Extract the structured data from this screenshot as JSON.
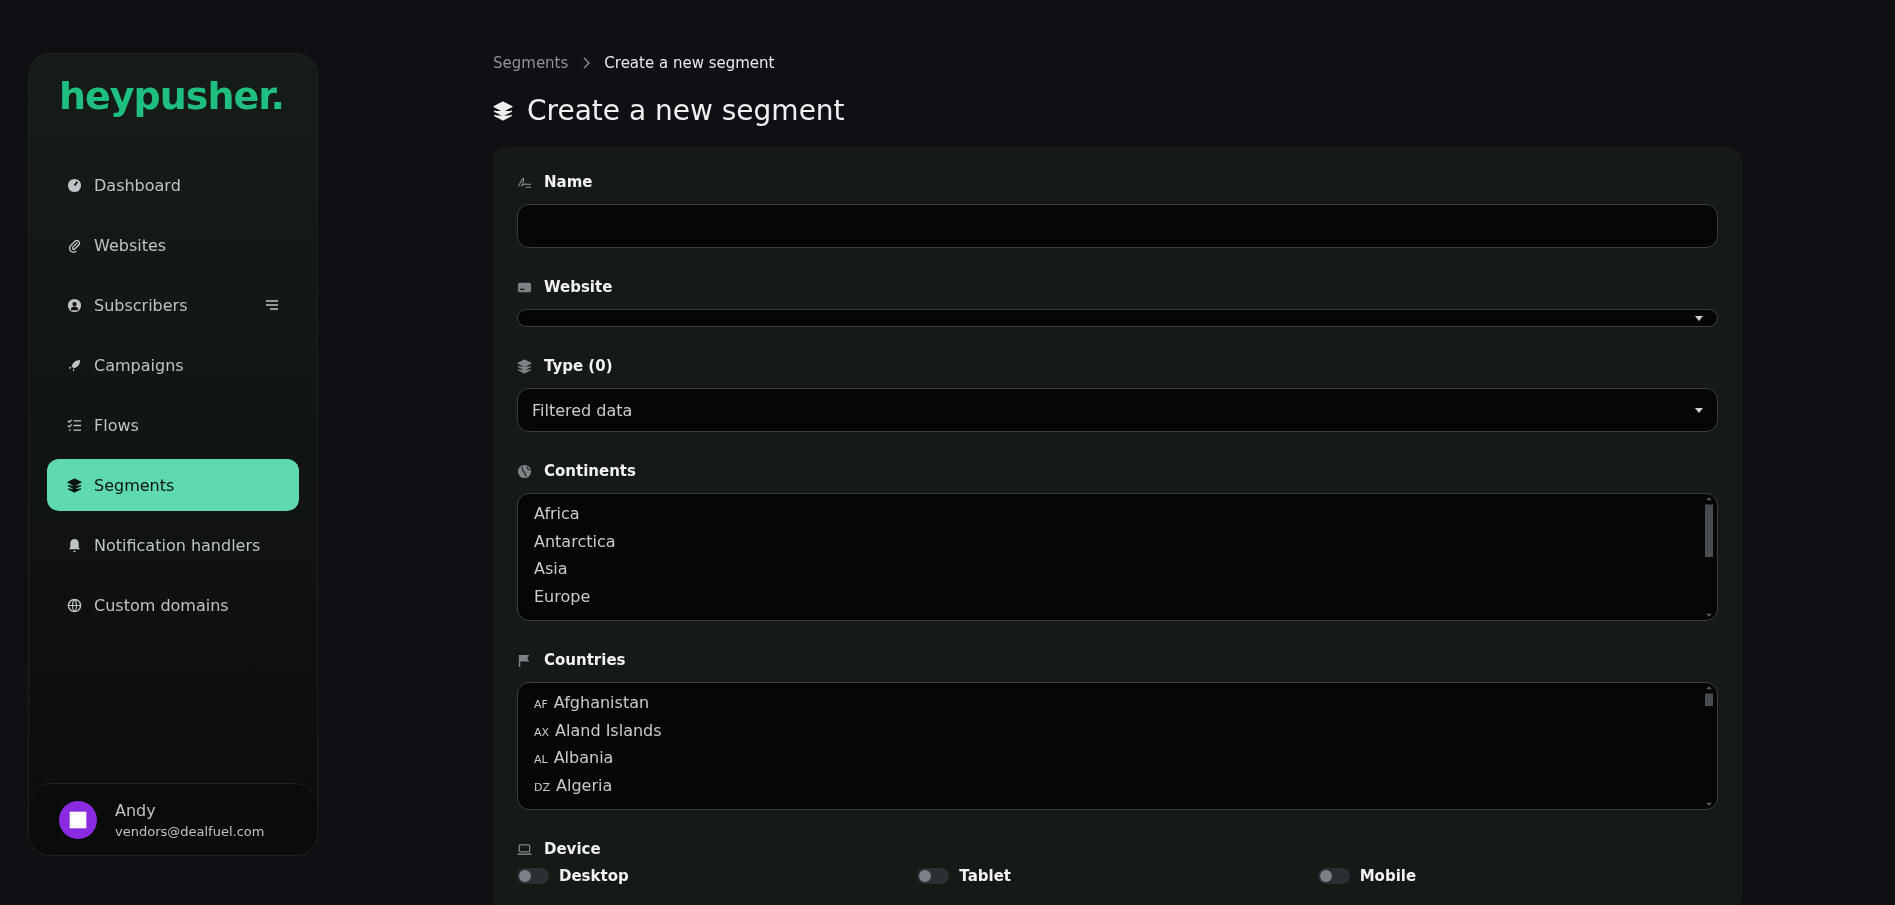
{
  "sidebar": {
    "logo": "heypusher.",
    "items": [
      {
        "label": "Dashboard",
        "selected": false
      },
      {
        "label": "Websites",
        "selected": false
      },
      {
        "label": "Subscribers",
        "selected": false,
        "has_submenu": true
      },
      {
        "label": "Campaigns",
        "selected": false
      },
      {
        "label": "Flows",
        "selected": false
      },
      {
        "label": "Segments",
        "selected": true
      },
      {
        "label": "Notification handlers",
        "selected": false
      },
      {
        "label": "Custom domains",
        "selected": false
      }
    ],
    "user": {
      "name": "Andy",
      "email": "vendors@dealfuel.com"
    }
  },
  "breadcrumb": [
    {
      "label": "Segments"
    },
    {
      "label": "Create a new segment"
    }
  ],
  "page_title": "Create a new segment",
  "form": {
    "fields": [
      {
        "kind": "text",
        "label": "Name"
      },
      {
        "kind": "select",
        "label": "Website"
      },
      {
        "kind": "select",
        "label": "Type (0)",
        "value": "Filtered data"
      },
      {
        "kind": "list",
        "label": "Continents",
        "options": [
          {
            "label": "Africa"
          },
          {
            "label": "Antarctica"
          },
          {
            "label": "Asia"
          },
          {
            "label": "Europe"
          }
        ]
      },
      {
        "kind": "list",
        "label": "Countries",
        "options": [
          {
            "code": "AF",
            "label": "Afghanistan"
          },
          {
            "code": "AX",
            "label": "Aland Islands"
          },
          {
            "code": "AL",
            "label": "Albania"
          },
          {
            "code": "DZ",
            "label": "Algeria"
          }
        ]
      },
      {
        "kind": "toggles",
        "label": "Device",
        "toggles": [
          {
            "label": "Desktop",
            "on": false
          },
          {
            "label": "Tablet",
            "on": false
          },
          {
            "label": "Mobile",
            "on": false
          }
        ]
      }
    ]
  }
}
